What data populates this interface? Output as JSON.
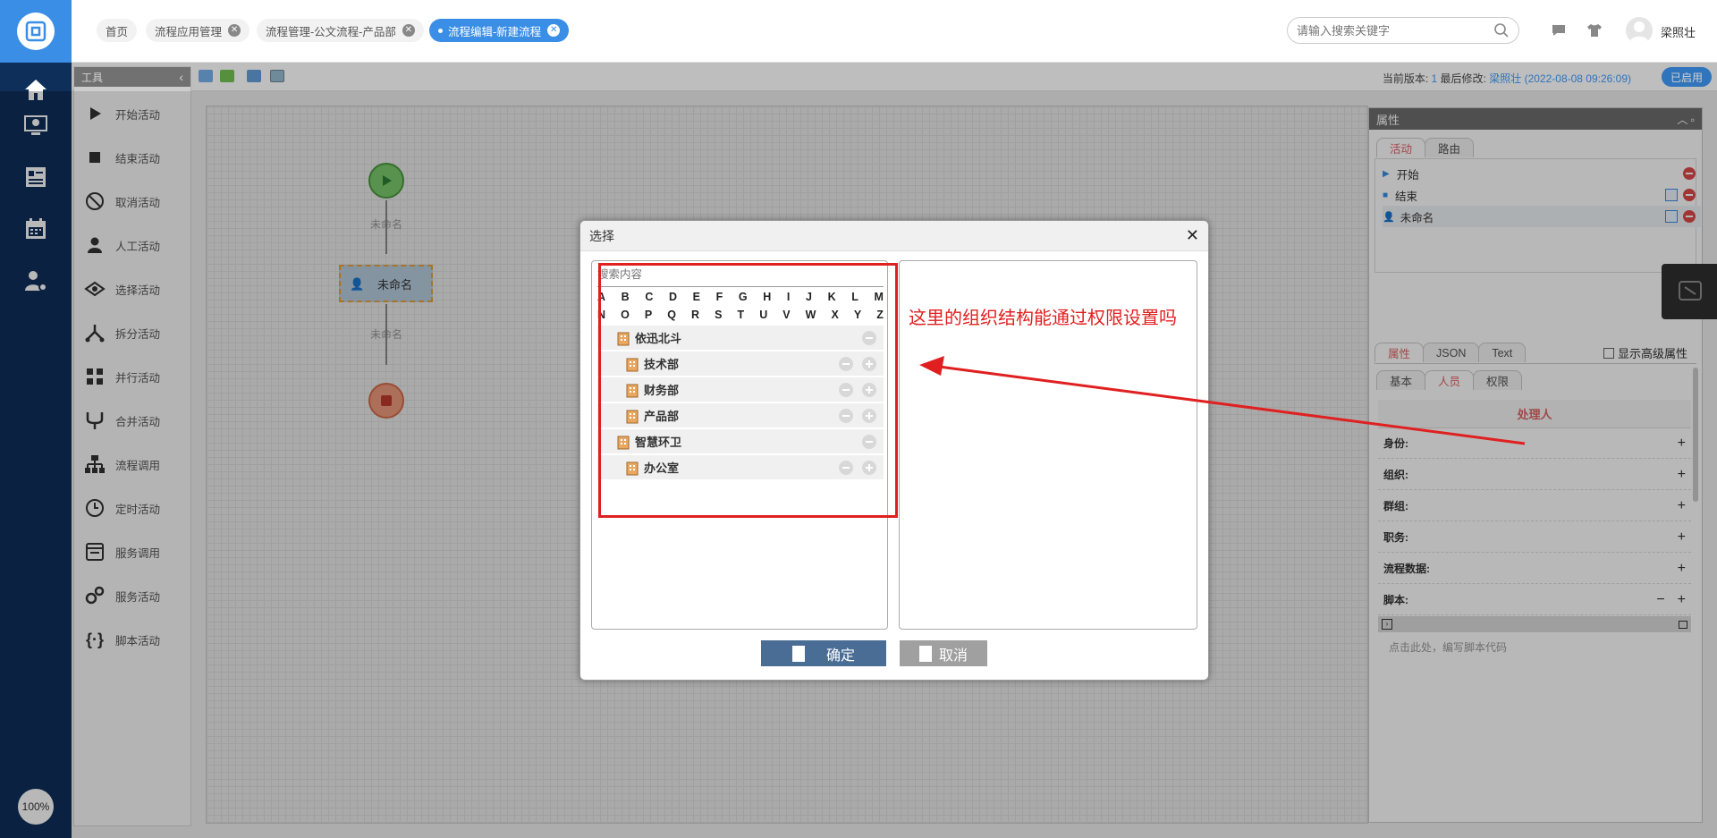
{
  "zoom_label": "100%",
  "tabs": [
    {
      "label": "首页"
    },
    {
      "label": "流程应用管理"
    },
    {
      "label": "流程管理-公文流程-产品部"
    },
    {
      "label": "流程编辑-新建流程"
    }
  ],
  "search": {
    "placeholder": "请输入搜索关键字"
  },
  "user": {
    "name": "梁照壮"
  },
  "status": {
    "version_label": "当前版本:",
    "version": "1",
    "modified_label": "最后修改:",
    "modified_by": "梁照壮",
    "modified_time": "(2022-08-08 09:26:09)",
    "enabled": "已启用"
  },
  "tools": {
    "title": "工具",
    "items": [
      {
        "label": "开始活动",
        "icon": "play-icon"
      },
      {
        "label": "结束活动",
        "icon": "stop-icon"
      },
      {
        "label": "取消活动",
        "icon": "cancel-icon"
      },
      {
        "label": "人工活动",
        "icon": "person-icon"
      },
      {
        "label": "选择活动",
        "icon": "choice-icon"
      },
      {
        "label": "拆分活动",
        "icon": "split-icon"
      },
      {
        "label": "并行活动",
        "icon": "parallel-icon"
      },
      {
        "label": "合并活动",
        "icon": "merge-icon"
      },
      {
        "label": "流程调用",
        "icon": "flow-call-icon"
      },
      {
        "label": "定时活动",
        "icon": "clock-icon"
      },
      {
        "label": "服务调用",
        "icon": "service-call-icon"
      },
      {
        "label": "服务活动",
        "icon": "service-gear-icon"
      },
      {
        "label": "脚本活动",
        "icon": "script-icon"
      }
    ]
  },
  "canvas": {
    "label1": "未命名",
    "node_label": "未命名",
    "label2": "未命名"
  },
  "props": {
    "title": "属性",
    "top_tabs": [
      "活动",
      "路由"
    ],
    "list": [
      {
        "label": "开始"
      },
      {
        "label": "结束"
      },
      {
        "label": "未命名"
      }
    ],
    "mid_tabs": [
      "属性",
      "JSON",
      "Text"
    ],
    "show_advanced": "显示高级属性",
    "sub_tabs": [
      "基本",
      "人员",
      "权限"
    ],
    "section_title": "处理人",
    "rows": [
      {
        "label": "身份:"
      },
      {
        "label": "组织:"
      },
      {
        "label": "群组:"
      },
      {
        "label": "职务:"
      },
      {
        "label": "流程数据:"
      },
      {
        "label": "脚本:"
      }
    ],
    "script_placeholder": "点击此处，编写脚本代码"
  },
  "dialog": {
    "title": "选择",
    "search_placeholder": "搜索内容",
    "letters_row1": [
      "A",
      "B",
      "C",
      "D",
      "E",
      "F",
      "G",
      "H",
      "I",
      "J",
      "K",
      "L",
      "M"
    ],
    "letters_row2": [
      "N",
      "O",
      "P",
      "Q",
      "R",
      "S",
      "T",
      "U",
      "V",
      "W",
      "X",
      "Y",
      "Z"
    ],
    "orgs": [
      {
        "label": "依迅北斗",
        "level": 0
      },
      {
        "label": "技术部",
        "level": 1
      },
      {
        "label": "财务部",
        "level": 1
      },
      {
        "label": "产品部",
        "level": 1
      },
      {
        "label": "智慧环卫",
        "level": 0
      },
      {
        "label": "办公室",
        "level": 1
      }
    ],
    "confirm": "确定",
    "cancel": "取消"
  },
  "annotation": "这里的组织结构能通过权限设置吗",
  "colors": {
    "accent": "#3a8ee6",
    "nav_bg": "#0e2f5a",
    "annotation": "#e02020"
  }
}
